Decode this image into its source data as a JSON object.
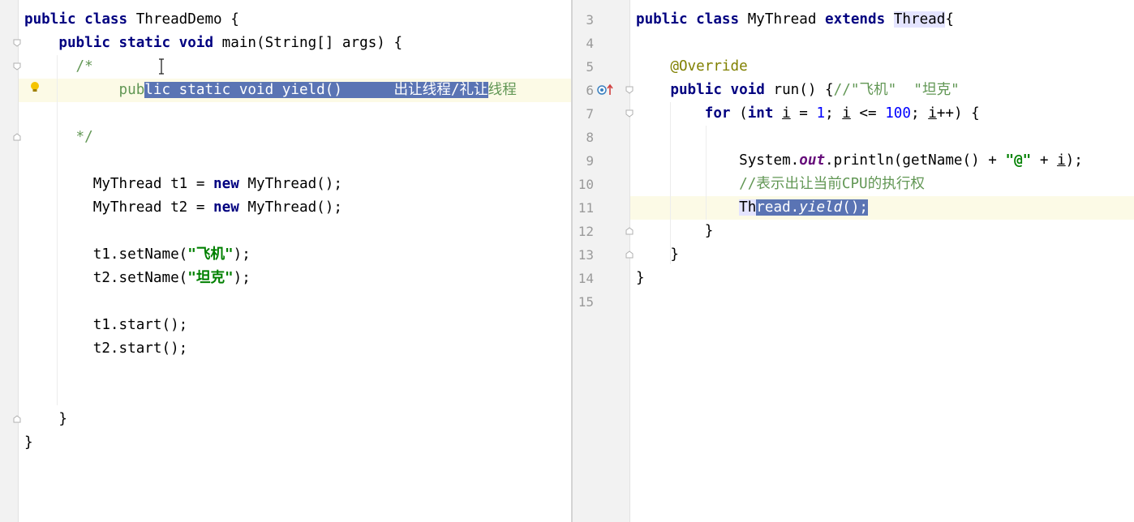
{
  "left": {
    "lines": [
      {
        "parts": [
          {
            "k": "kw",
            "t": "public class "
          },
          {
            "k": "",
            "t": "ThreadDemo {"
          }
        ]
      },
      {
        "parts": [
          {
            "k": "",
            "t": "    "
          },
          {
            "k": "kw",
            "t": "public static void "
          },
          {
            "k": "",
            "t": "main(String[] args) {"
          }
        ]
      },
      {
        "parts": [
          {
            "k": "cm",
            "t": "      /*"
          }
        ]
      },
      {
        "parts": [
          {
            "k": "cm",
            "t": "           pub"
          },
          {
            "k": "sel",
            "t": "lic static void yield()      出让线程/礼让"
          },
          {
            "k": "cm",
            "t": "线程"
          }
        ]
      },
      {
        "parts": [
          {
            "k": "",
            "t": ""
          }
        ]
      },
      {
        "parts": [
          {
            "k": "cm",
            "t": "      */"
          }
        ]
      },
      {
        "parts": [
          {
            "k": "",
            "t": ""
          }
        ]
      },
      {
        "parts": [
          {
            "k": "",
            "t": "        MyThread t1 = "
          },
          {
            "k": "kw",
            "t": "new "
          },
          {
            "k": "",
            "t": "MyThread();"
          }
        ]
      },
      {
        "parts": [
          {
            "k": "",
            "t": "        MyThread t2 = "
          },
          {
            "k": "kw",
            "t": "new "
          },
          {
            "k": "",
            "t": "MyThread();"
          }
        ]
      },
      {
        "parts": [
          {
            "k": "",
            "t": ""
          }
        ]
      },
      {
        "parts": [
          {
            "k": "",
            "t": "        t1.setName("
          },
          {
            "k": "str",
            "t": "\"飞机\""
          },
          {
            "k": "",
            "t": ");"
          }
        ]
      },
      {
        "parts": [
          {
            "k": "",
            "t": "        t2.setName("
          },
          {
            "k": "str",
            "t": "\"坦克\""
          },
          {
            "k": "",
            "t": ");"
          }
        ]
      },
      {
        "parts": [
          {
            "k": "",
            "t": ""
          }
        ]
      },
      {
        "parts": [
          {
            "k": "",
            "t": "        t1.start();"
          }
        ]
      },
      {
        "parts": [
          {
            "k": "",
            "t": "        t2.start();"
          }
        ]
      },
      {
        "parts": [
          {
            "k": "",
            "t": ""
          }
        ]
      },
      {
        "parts": [
          {
            "k": "",
            "t": ""
          }
        ]
      },
      {
        "parts": [
          {
            "k": "",
            "t": "    }"
          }
        ]
      },
      {
        "parts": [
          {
            "k": "",
            "t": "}"
          }
        ]
      }
    ]
  },
  "right": {
    "line_numbers": [
      "3",
      "4",
      "5",
      "6",
      "7",
      "8",
      "9",
      "10",
      "11",
      "12",
      "13",
      "14",
      "15"
    ],
    "lines": [
      {
        "parts": [
          {
            "k": "kw",
            "t": "public class "
          },
          {
            "k": "",
            "t": "MyThread "
          },
          {
            "k": "kw",
            "t": "extends "
          },
          {
            "k": "typehl",
            "t": "Thread"
          },
          {
            "k": "",
            "t": "{"
          }
        ]
      },
      {
        "parts": [
          {
            "k": "",
            "t": ""
          }
        ]
      },
      {
        "parts": [
          {
            "k": "ann",
            "t": "    @Override"
          }
        ]
      },
      {
        "parts": [
          {
            "k": "",
            "t": "    "
          },
          {
            "k": "kw",
            "t": "public void "
          },
          {
            "k": "",
            "t": "run() {"
          },
          {
            "k": "cm",
            "t": "//\"飞机\"  \"坦克\""
          }
        ]
      },
      {
        "parts": [
          {
            "k": "",
            "t": "        "
          },
          {
            "k": "kw",
            "t": "for "
          },
          {
            "k": "",
            "t": "("
          },
          {
            "k": "kw",
            "t": "int "
          },
          {
            "k": "ul",
            "t": "i"
          },
          {
            "k": "",
            "t": " = "
          },
          {
            "k": "num",
            "t": "1"
          },
          {
            "k": "",
            "t": "; "
          },
          {
            "k": "ul",
            "t": "i"
          },
          {
            "k": "",
            "t": " <= "
          },
          {
            "k": "num",
            "t": "100"
          },
          {
            "k": "",
            "t": "; "
          },
          {
            "k": "ul",
            "t": "i"
          },
          {
            "k": "",
            "t": "++) {"
          }
        ]
      },
      {
        "parts": [
          {
            "k": "",
            "t": ""
          }
        ]
      },
      {
        "parts": [
          {
            "k": "",
            "t": "            System."
          },
          {
            "k": "fld",
            "t": "out"
          },
          {
            "k": "",
            "t": ".println(getName() + "
          },
          {
            "k": "str",
            "t": "\"@\""
          },
          {
            "k": "",
            "t": " + "
          },
          {
            "k": "ul",
            "t": "i"
          },
          {
            "k": "",
            "t": ");"
          }
        ]
      },
      {
        "parts": [
          {
            "k": "cm",
            "t": "            //表示出让当前CPU的执行权"
          }
        ]
      },
      {
        "parts": [
          {
            "k": "",
            "t": "            "
          },
          {
            "k": "typehl",
            "t": "Th"
          },
          {
            "k": "sel",
            "t": "read."
          },
          {
            "k": "sel ital",
            "t": "yield"
          },
          {
            "k": "sel",
            "t": "();"
          }
        ]
      },
      {
        "parts": [
          {
            "k": "",
            "t": "        }"
          }
        ]
      },
      {
        "parts": [
          {
            "k": "",
            "t": "    }"
          }
        ]
      },
      {
        "parts": [
          {
            "k": "",
            "t": "}"
          }
        ]
      },
      {
        "parts": [
          {
            "k": "",
            "t": ""
          }
        ]
      }
    ]
  },
  "icons": {
    "bulb": "lightbulb-icon",
    "override": "override-marker-icon",
    "fold": "fold-marker-icon",
    "cursor": "text-cursor-icon"
  }
}
